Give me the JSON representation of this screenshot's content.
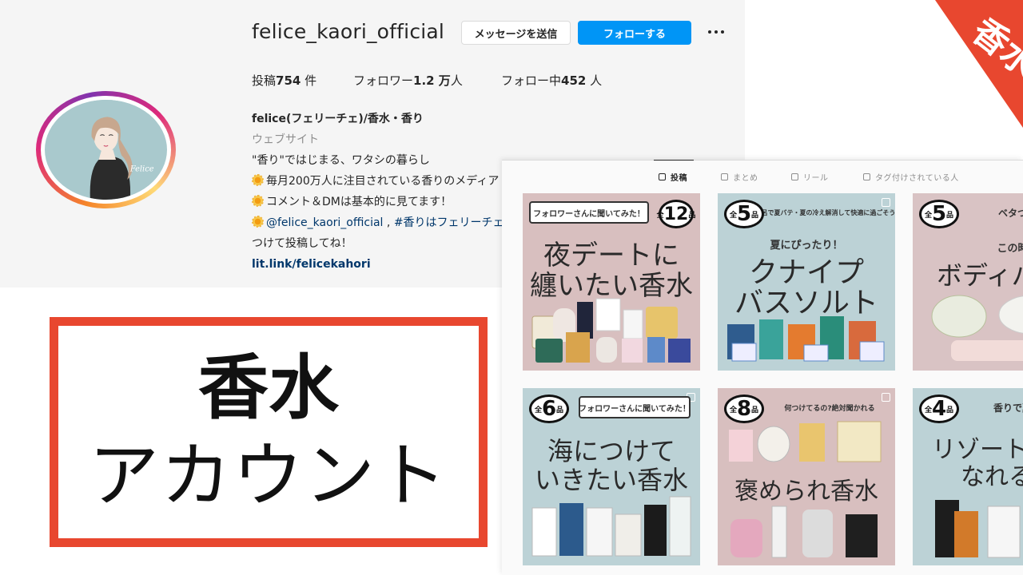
{
  "profile": {
    "username": "felice_kaori_official",
    "message_button": "メッセージを送信",
    "follow_button": "フォローする",
    "stats": {
      "posts_label": "投稿",
      "posts_value": "754",
      "posts_unit": " 件",
      "followers_label": "フォロワー",
      "followers_value": "1.2 万",
      "followers_unit": "人",
      "following_label": "フォロー中",
      "following_value": "452",
      "following_unit": " 人"
    },
    "bio": {
      "name": "felice(フェリーチェ)/香水・香り",
      "category": "ウェブサイト",
      "line1": "\"香り\"ではじまる、ワタシの暮らし",
      "line2": "毎月200万人に注目されている香りのメディア",
      "line3": "コメント＆DMは基本的に見てます！",
      "line4_mention": "@felice_kaori_official",
      "line4_sep": " , ",
      "line4_tag": "#香りはフェリーチェ",
      "line5": "つけて投稿してね！",
      "link": "lit.link/felicekahori"
    },
    "avatar_text": "Felice"
  },
  "callout": {
    "line1": "香水",
    "line2": "アカウント"
  },
  "ribbon": {
    "text": "香水",
    "color": "#e8472f"
  },
  "tabs": {
    "posts": "投稿",
    "guides": "まとめ",
    "reels": "リール",
    "tagged": "タグ付けされている人"
  },
  "posts": [
    {
      "banner": "フォロワーさんに聞いてみた！",
      "badge_prefix": "全",
      "badge_num": "12",
      "badge_unit": "品",
      "title_line1": "夜デートに",
      "title_line2": "纏いたい香水",
      "bg": "#d8bfbf"
    },
    {
      "banner": "お風呂で夏バテ・夏の冷え解消して快適に過ごそう♪",
      "badge_prefix": "全",
      "badge_num": "5",
      "badge_unit": "品",
      "subtitle": "夏にぴったり！",
      "title_line1": "クナイプ",
      "title_line2": "バスソルト",
      "bg": "#bcd2d6"
    },
    {
      "banner": "ベタつき瞬間サラ",
      "badge_prefix": "全",
      "badge_num": "5",
      "badge_unit": "品",
      "subtitle": "この時期必須ア",
      "title_line1": "ボディパウ",
      "bg": "#d9c3c4"
    },
    {
      "banner": "フォロワーさんに聞いてみた！",
      "badge_prefix": "全",
      "badge_num": "6",
      "badge_unit": "品",
      "title_line1": "海につけて",
      "title_line2": "いきたい香水",
      "bg": "#bcd2d6"
    },
    {
      "banner": "何つけてるの?絶対聞かれる",
      "badge_prefix": "全",
      "badge_num": "8",
      "badge_unit": "品",
      "title_line1": "褒められ香水",
      "bg": "#d8bfbf"
    },
    {
      "banner": "香りで夏しちゃい",
      "badge_prefix": "全",
      "badge_num": "4",
      "badge_unit": "品",
      "title_line1": "リゾート気",
      "title_line2": "なれる香",
      "bg": "#bcd2d6"
    }
  ]
}
